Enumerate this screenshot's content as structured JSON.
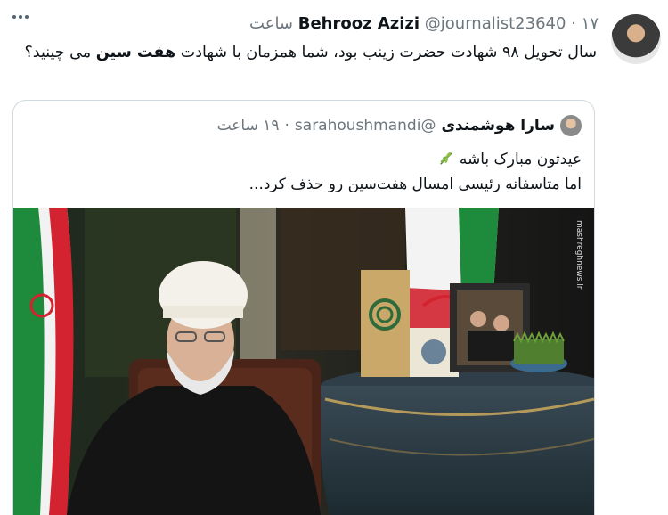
{
  "tweet": {
    "author_name": "Behrooz Azizi",
    "author_handle": "@journalist23640",
    "time": "۱۷ ساعت",
    "separator": "·",
    "text_part1": "سال تحویل ۹۸ شهادت حضرت زینب بود، شما همزمان با شهادت ",
    "text_bold": "هفت سین",
    "text_part2": " می چینید؟"
  },
  "quoted": {
    "author_name": "سارا هوشمندی",
    "author_handle": "@sarahoushmandi",
    "time": "۱۹ ساعت",
    "separator": "·",
    "line1": "عیدتون مبارک باشه",
    "line2": "اما متاسفانه رئیسی امسال هفت‌سین رو حذف کرد...",
    "media_watermark": "mashreghnews.ir"
  },
  "icons": {
    "more": "more-horizontal-icon",
    "leaf": "herb-emoji-icon"
  },
  "colors": {
    "text": "#0f1419",
    "secondary": "#6e767d",
    "border": "#cfd9de"
  }
}
